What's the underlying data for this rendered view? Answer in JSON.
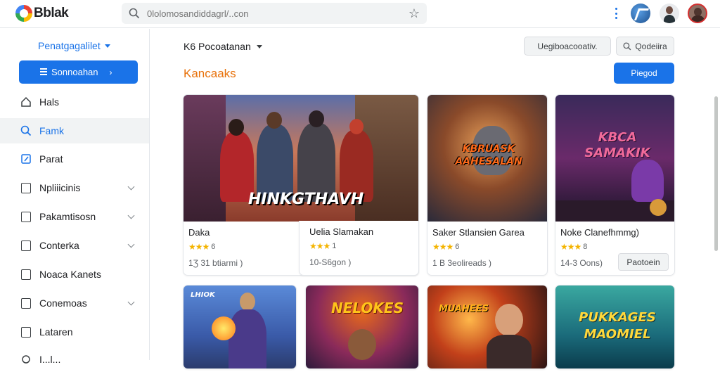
{
  "app": {
    "name": "Bblak"
  },
  "search": {
    "placeholder": "0lolomosandiddagrl/..con"
  },
  "sidebar": {
    "header": "Penatgagalilet",
    "primary_button": "Sonnoahan",
    "items": [
      {
        "label": "Hals",
        "icon": "home-icon",
        "active": false,
        "expand": false
      },
      {
        "label": "Famk",
        "icon": "search-icon",
        "active": true,
        "expand": false
      },
      {
        "label": "Parat",
        "icon": "edit-icon",
        "active": false,
        "expand": false
      },
      {
        "label": "Npliiicinis",
        "icon": "book-icon",
        "active": false,
        "expand": true
      },
      {
        "label": "Pakamtisosn",
        "icon": "settings-icon",
        "active": false,
        "expand": true
      },
      {
        "label": "Conterka",
        "icon": "contacts-icon",
        "active": false,
        "expand": true
      },
      {
        "label": "Noaca Kanets",
        "icon": "document-icon",
        "active": false,
        "expand": false
      },
      {
        "label": "Conemoas",
        "icon": "folder-icon",
        "active": false,
        "expand": true
      },
      {
        "label": "Lataren",
        "icon": "chart-icon",
        "active": false,
        "expand": false
      },
      {
        "label": "I...l...",
        "icon": "more-icon",
        "active": false,
        "expand": false
      }
    ]
  },
  "main": {
    "filter_label": "K6 Pocoatanan",
    "button_a": "Uegiboacooativ.",
    "button_b": "Qodeiira",
    "section_title": "Kancaaks",
    "primary_button": "Piegod",
    "cards": [
      {
        "title": "Daka",
        "stars": "★★★",
        "rating": "6",
        "meta": "1Ʒ 31 btiarmi )",
        "art_text": "HINKGTHAVH",
        "button": ""
      },
      {
        "title": "Uelia Slamakan",
        "stars": "★★★",
        "rating": "1",
        "meta": "10-S6gon )",
        "art_text": "",
        "button": ""
      },
      {
        "title": "Saker Stlansien Garea",
        "stars": "★★★",
        "rating": "6",
        "meta": "1 B 3eolireads )",
        "art_text": "KBRUASK AAHESALAN",
        "button": ""
      },
      {
        "title": "Noke Clanefhmmg)",
        "stars": "★★★",
        "rating": "8",
        "meta": "14-3 Oons)",
        "art_text": "KBCA SAMAKIK",
        "button": "Paotoein"
      }
    ],
    "row2_cards": [
      {
        "art_text": "LHIOK"
      },
      {
        "art_text": "NELOKES"
      },
      {
        "art_text": "MUAHEES"
      },
      {
        "art_text": "PUKKAGES MAOMIEL"
      }
    ]
  }
}
